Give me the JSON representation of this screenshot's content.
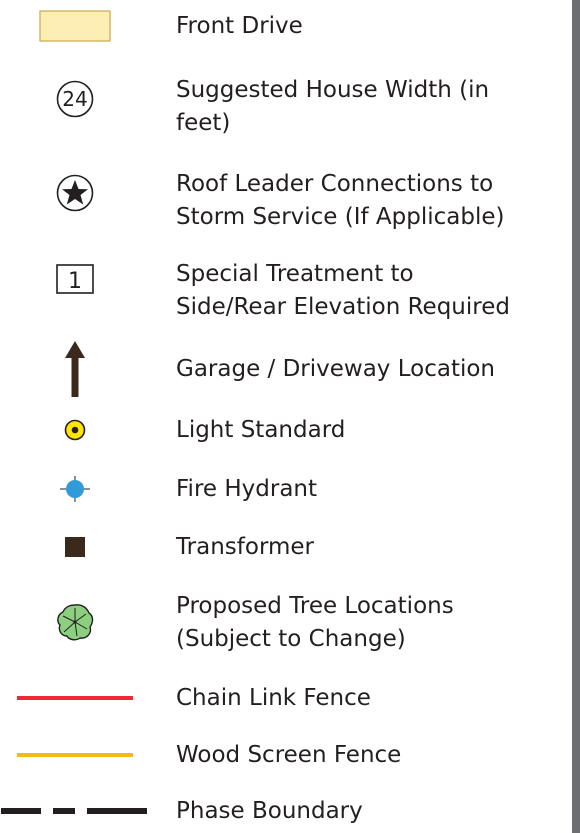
{
  "legend": {
    "items": [
      {
        "label": "Front Drive",
        "icon": "front-drive-swatch"
      },
      {
        "label": "Suggested House Width (in\nfeet)",
        "icon": "house-width-circle-icon",
        "symbol_text": "24"
      },
      {
        "label": "Roof Leader Connections to\nStorm Service (If Applicable)",
        "icon": "star-circle-icon"
      },
      {
        "label": "Special Treatment to\nSide/Rear Elevation Required",
        "icon": "numbered-box-icon",
        "symbol_text": "1"
      },
      {
        "label": "Garage  / Driveway Location",
        "icon": "arrow-up-icon"
      },
      {
        "label": "Light Standard",
        "icon": "light-standard-icon"
      },
      {
        "label": "Fire Hydrant",
        "icon": "fire-hydrant-icon"
      },
      {
        "label": "Transformer",
        "icon": "transformer-icon"
      },
      {
        "label": "Proposed Tree Locations\n(Subject to Change)",
        "icon": "tree-icon"
      },
      {
        "label": "Chain Link Fence",
        "icon": "chain-link-fence-line"
      },
      {
        "label": "Wood Screen Fence",
        "icon": "wood-screen-fence-line"
      },
      {
        "label": "Phase Boundary",
        "icon": "phase-boundary-dashed-line"
      }
    ]
  },
  "colors": {
    "front_drive_fill": "#fdeeb4",
    "front_drive_stroke": "#c9a84a",
    "arrow": "#3b2a1c",
    "light_standard": "#ffe600",
    "fire_hydrant": "#2f9bd8",
    "transformer": "#3b2a1c",
    "tree": "#8ccf7e",
    "chain_link": "#ea2a35",
    "wood_screen": "#f7b718",
    "phase_boundary": "#231f20",
    "border": "#6d6e71"
  }
}
